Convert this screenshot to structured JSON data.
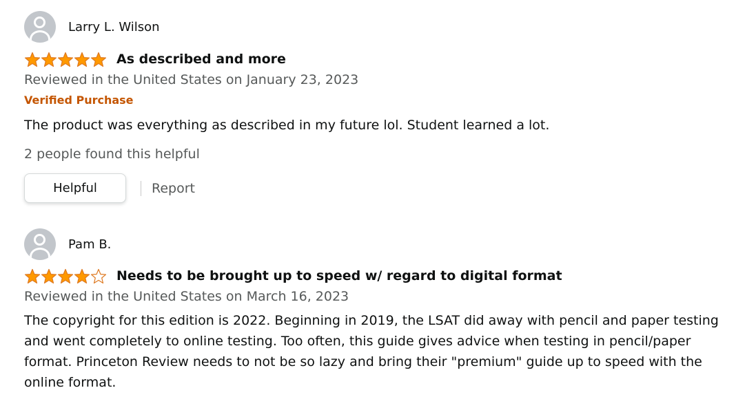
{
  "reviews": [
    {
      "profile_name": "Larry L. Wilson",
      "rating": 5,
      "rating_max": 5,
      "title": "As described and more",
      "date": "Reviewed in the United States on January 23, 2023",
      "verified": "Verified Purchase",
      "body": "The product was everything as described in my future lol. Student learned a lot.",
      "helpful_count": "2 people found this helpful",
      "helpful_label": "Helpful",
      "report_label": "Report"
    },
    {
      "profile_name": "Pam B.",
      "rating": 4,
      "rating_max": 5,
      "title": "Needs to be brought up to speed w/ regard to digital format",
      "date": "Reviewed in the United States on March 16, 2023",
      "body": "The copyright for this edition is 2022. Beginning in 2019, the LSAT did away with pencil and paper testing and went completely to online testing. Too often, this guide gives advice when testing in pencil/paper format. Princeton Review needs to not be so lazy and bring their \"premium\" guide up to speed with the online format."
    }
  ],
  "colors": {
    "star": "#ff9900",
    "star_stroke": "#de7921",
    "verified": "#c45500",
    "secondary_text": "#565959"
  },
  "icons": {
    "avatar": "default-user-avatar-icon",
    "star_filled": "star-filled-icon",
    "star_empty": "star-empty-icon"
  }
}
